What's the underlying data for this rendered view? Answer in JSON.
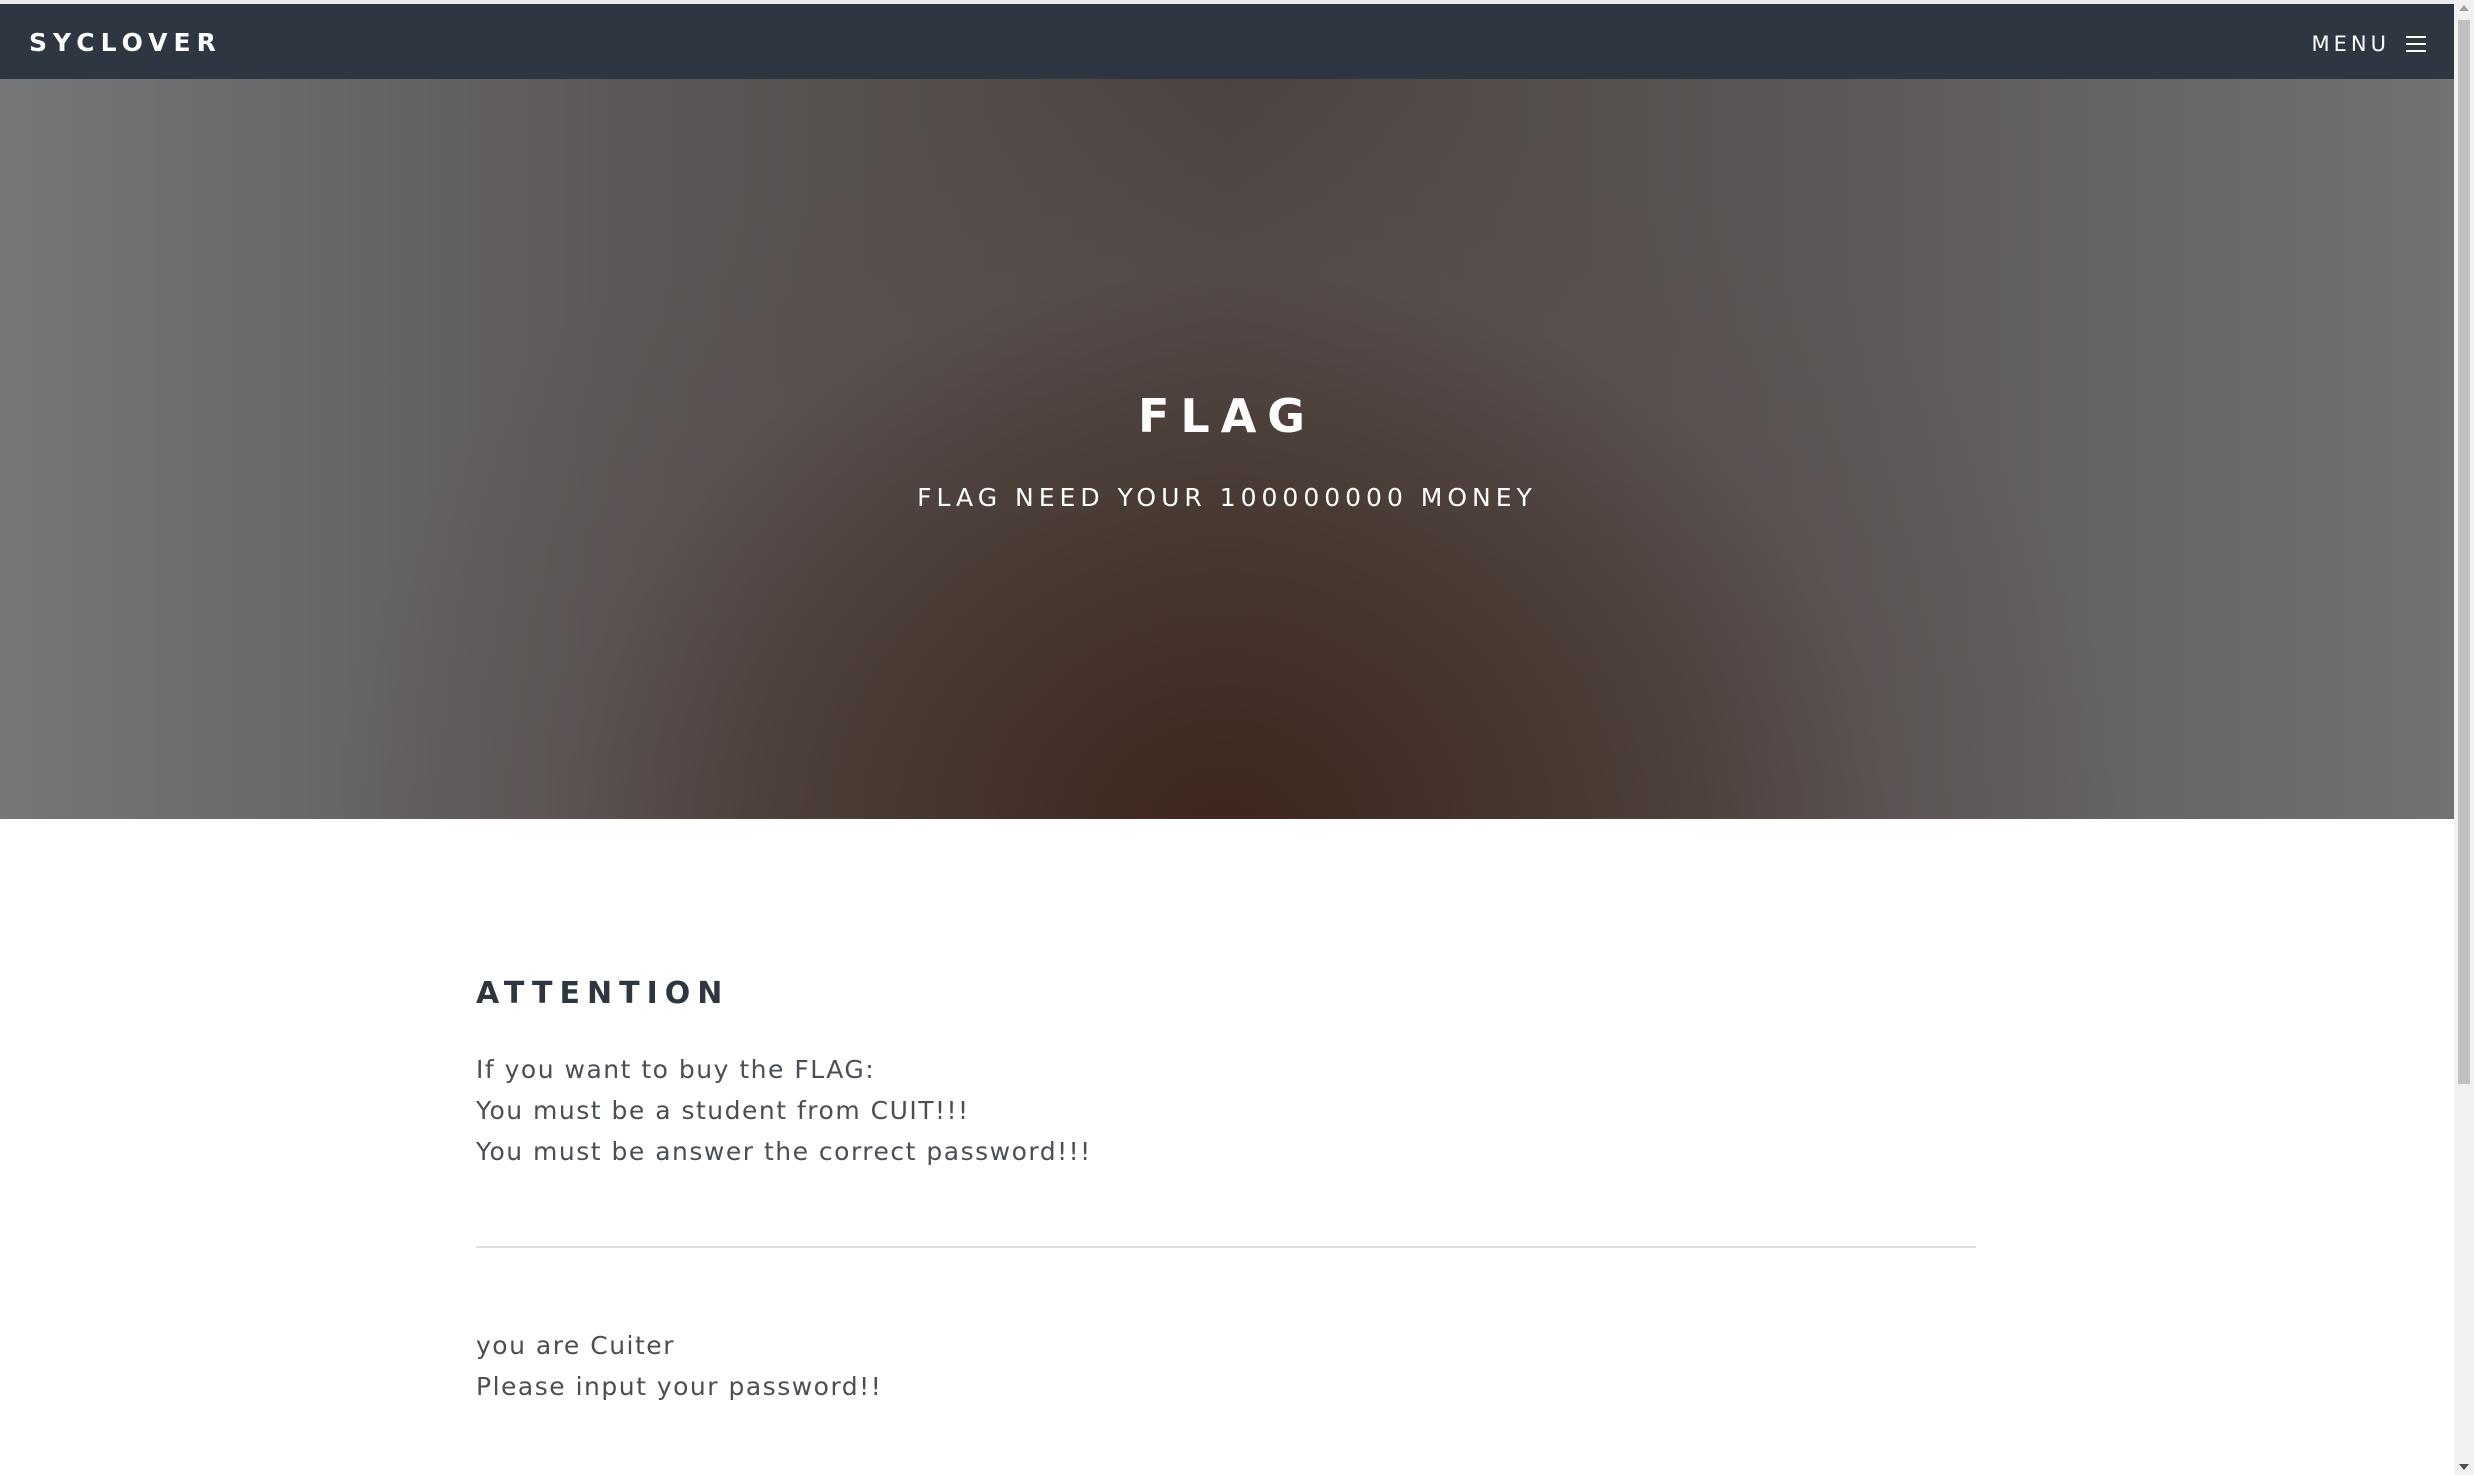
{
  "navbar": {
    "brand": "SYCLOVER",
    "menu_label": "MENU",
    "menu_icon": "hamburger-icon"
  },
  "hero": {
    "title": "FLAG",
    "subtitle": "FLAG NEED YOUR 100000000 MONEY"
  },
  "main": {
    "heading": "ATTENTION",
    "intro_lines": [
      "If you want to buy the FLAG:",
      "You must be a student from CUIT!!!",
      "You must be answer the correct password!!!"
    ],
    "status_lines": [
      "you are Cuiter",
      "Please input your password!!"
    ]
  },
  "colors": {
    "navbar_bg": "#2e3741",
    "heading": "#2e3741",
    "body_text": "#4a4f55"
  }
}
